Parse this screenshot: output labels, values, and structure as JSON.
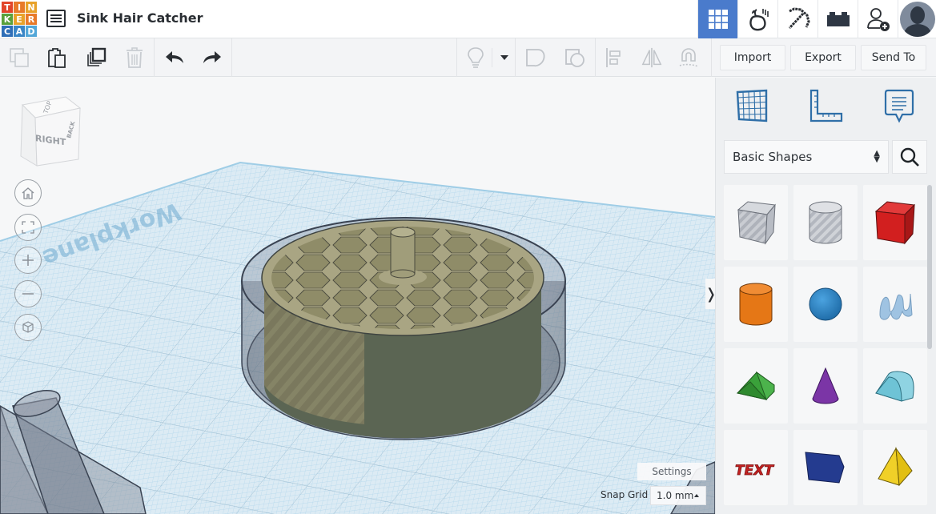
{
  "app": {
    "logo_letters": [
      "T",
      "I",
      "N",
      "K",
      "E",
      "R",
      "C",
      "A",
      "D"
    ],
    "logo_colors": [
      "#e2462b",
      "#e87a2a",
      "#e8a22a",
      "#5aa13c",
      "#e8a22a",
      "#e87a2a",
      "#2f6fb7",
      "#3a86c6",
      "#53a7d8"
    ],
    "project_title": "Sink Hair Catcher",
    "accent_color": "#4a7bcc"
  },
  "header": {
    "menu_icon": "design-list-icon",
    "right_buttons": [
      {
        "id": "3d-design",
        "icon": "grid-icon",
        "active": true
      },
      {
        "id": "sim-lab",
        "icon": "falling-apple-icon",
        "active": false
      },
      {
        "id": "minecraft",
        "icon": "pickaxe-icon",
        "active": false
      },
      {
        "id": "bricks",
        "icon": "brick-icon",
        "active": false
      },
      {
        "id": "invite",
        "icon": "add-user-icon",
        "active": false
      }
    ],
    "avatar": "user-avatar"
  },
  "toolbar": {
    "left_icons": [
      "copy-icon",
      "paste-icon",
      "duplicate-icon",
      "delete-icon",
      "undo-icon",
      "redo-icon"
    ],
    "right_icons": [
      "light-bulb-icon",
      "dropdown-arrow-icon",
      "group-shapes-icon",
      "ungroup-icon",
      "align-icon",
      "mirror-icon",
      "cruise-magnet-icon"
    ],
    "import_label": "Import",
    "export_label": "Export",
    "send_to_label": "Send To"
  },
  "viewport": {
    "viewcube_front": "RIGHT",
    "viewcube_side": "BACK",
    "viewcube_top": "TOP",
    "workplane_label": "Workplane",
    "nav_buttons": [
      "home-view",
      "fit-view",
      "zoom-in",
      "zoom-out",
      "perspective-toggle"
    ],
    "settings_label": "Settings",
    "snap_grid_label": "Snap Grid",
    "snap_grid_value": "1.0 mm",
    "collapse_label": "❭"
  },
  "panel": {
    "tabs": [
      "workplane-tab",
      "ruler-tab",
      "notes-tab"
    ],
    "category": "Basic Shapes",
    "shapes": [
      {
        "name": "Box Hole",
        "color": "#b8bcc4"
      },
      {
        "name": "Cylinder Hole",
        "color": "#c4c7cc"
      },
      {
        "name": "Box",
        "color": "#d21f1f"
      },
      {
        "name": "Cylinder",
        "color": "#e57716"
      },
      {
        "name": "Sphere",
        "color": "#2a87c9"
      },
      {
        "name": "Scribble",
        "color": "#9fc3e2"
      },
      {
        "name": "Roof",
        "color": "#3aa13a"
      },
      {
        "name": "Cone",
        "color": "#7b35a6"
      },
      {
        "name": "Round Roof",
        "color": "#6ec3d6"
      },
      {
        "name": "Text",
        "color": "#c42222"
      },
      {
        "name": "Polygon",
        "color": "#243b8f"
      },
      {
        "name": "Pyramid",
        "color": "#f0d028"
      }
    ]
  }
}
